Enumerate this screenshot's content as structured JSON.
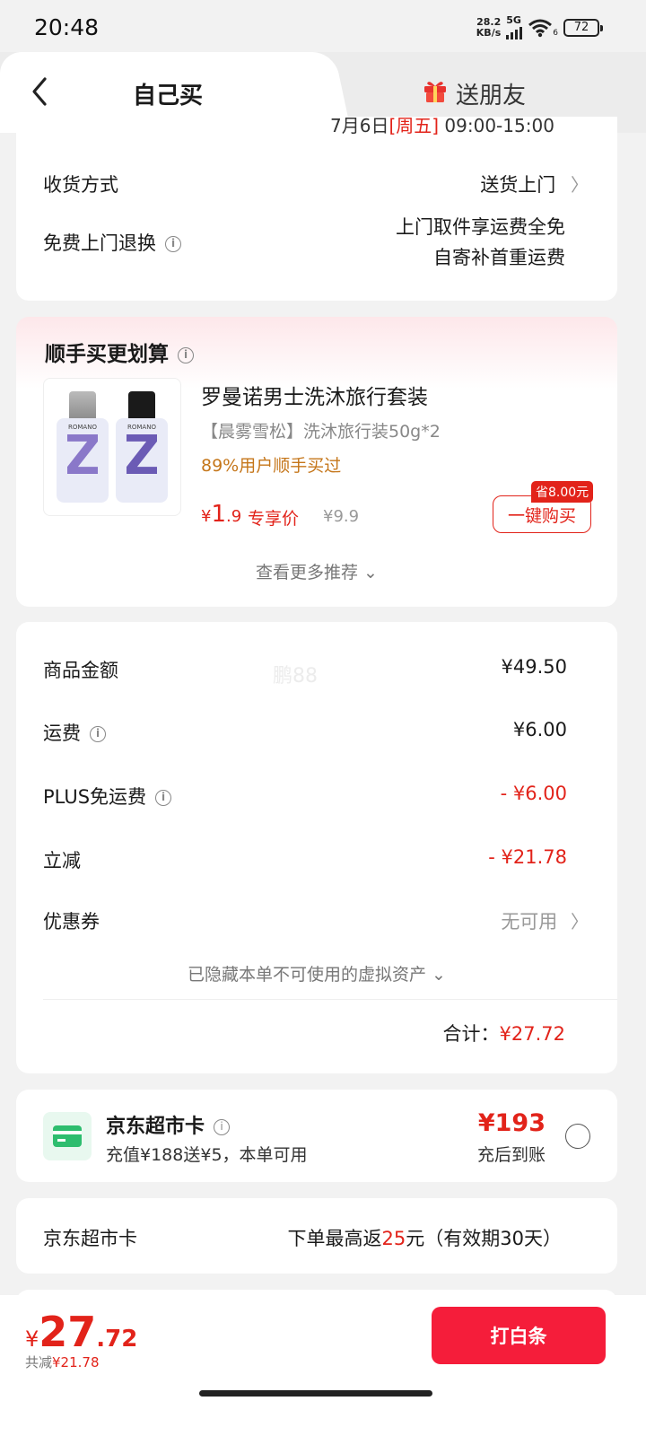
{
  "status_bar": {
    "time": "20:48",
    "net_speed_value": "28.2",
    "net_speed_unit": "KB/s",
    "network_type": "5G",
    "wifi_sub": "6",
    "battery": "72"
  },
  "tabs": {
    "self_buy": "自己买",
    "gift_friend": "送朋友"
  },
  "delivery": {
    "clipped_date_prefix": "7月6日",
    "clipped_date_red": "[周五]",
    "clipped_date_time": "09:00-15:00",
    "method_label": "收货方式",
    "method_value": "送货上门",
    "return_label": "免费上门退换",
    "return_line1": "上门取件享运费全免",
    "return_line2": "自寄补首重运费"
  },
  "upsell": {
    "title": "顺手买更划算",
    "product_name": "罗曼诺男士洗沐旅行套装",
    "product_spec": "【晨雾雪松】洗沐旅行装50g*2",
    "bought_text": "89%用户顺手买过",
    "price_symbol": "¥",
    "price_int": "1",
    "price_dec": ".9",
    "price_tag": "专享价",
    "orig_price": "¥9.9",
    "save_badge": "省8.00元",
    "buy_button": "一键购买",
    "more": "查看更多推荐 ⌄",
    "bottle_brand": "ROMANO"
  },
  "summary": {
    "watermark": "鹏88",
    "items": [
      {
        "label": "商品金额",
        "value": "¥49.50"
      },
      {
        "label": "运费",
        "value": "¥6.00"
      },
      {
        "label": "PLUS免运费",
        "value": "- ¥6.00"
      },
      {
        "label": "立减",
        "value": "- ¥21.78"
      },
      {
        "label": "优惠券",
        "value": "无可用"
      }
    ],
    "hidden_assets": "已隐藏本单不可使用的虚拟资产 ⌄",
    "total_label": "合计：",
    "total_value": "¥27.72"
  },
  "supermarket_card": {
    "title": "京东超市卡",
    "desc": "充值¥188送¥5，本单可用",
    "amount": "¥193",
    "note": "充后到账"
  },
  "rebate": {
    "label": "京东超市卡",
    "value_prefix": "下单最高返",
    "value_amount": "25",
    "value_suffix": "元（有效期30天）"
  },
  "bottom": {
    "price_symbol": "¥",
    "price_int": "27",
    "price_dec": ".72",
    "saved_prefix": "共减",
    "saved_value": "¥21.78",
    "pay_button": "打白条"
  },
  "colors": {
    "accent_red": "#e2231a",
    "pay_button": "#f51d3a",
    "card_green": "#2dbd6e"
  }
}
